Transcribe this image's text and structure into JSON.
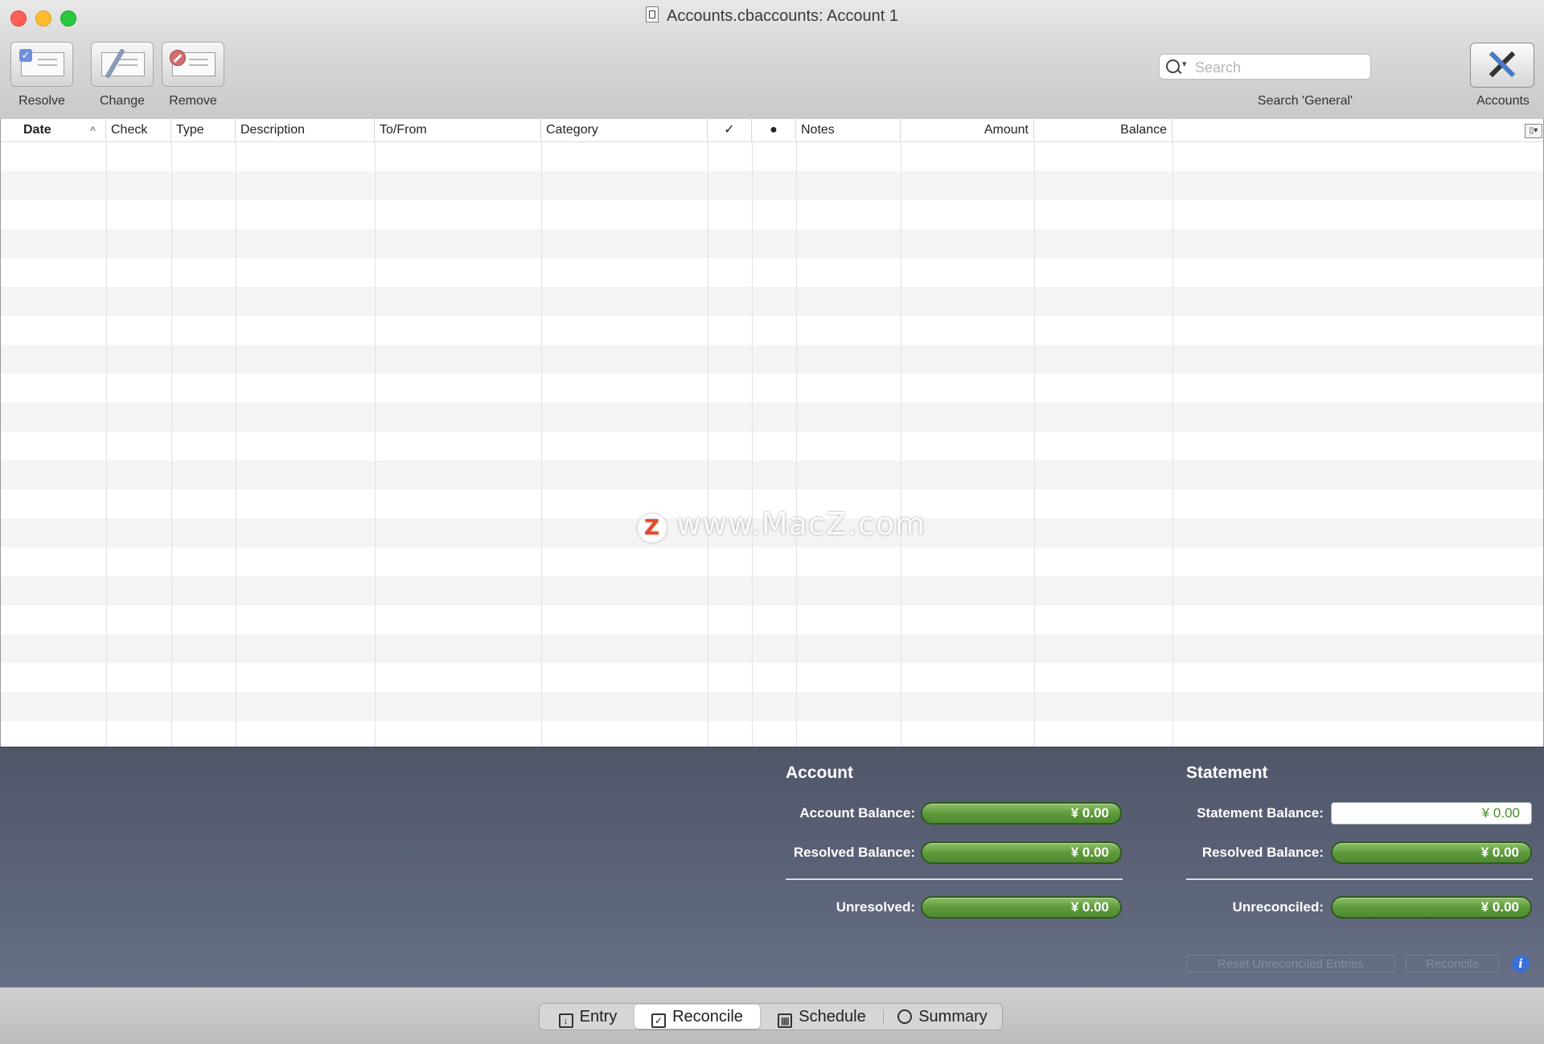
{
  "window": {
    "title": "Accounts.cbaccounts:  Account 1"
  },
  "toolbar": {
    "resolve_label": "Resolve",
    "change_label": "Change",
    "remove_label": "Remove",
    "search_placeholder": "Search",
    "search_caption": "Search 'General'",
    "accounts_label": "Accounts"
  },
  "table": {
    "columns": [
      "Date",
      "Check",
      "Type",
      "Description",
      "To/From",
      "Category",
      "✓",
      "●",
      "Notes",
      "Amount",
      "Balance"
    ],
    "sort_indicator": "^",
    "column_menu_icon": "▯▾",
    "rows": []
  },
  "watermark": {
    "logo_letter": "Z",
    "text": "www.MacZ.com"
  },
  "reconcile": {
    "account": {
      "title": "Account",
      "account_balance_label": "Account Balance:",
      "account_balance": "¥ 0.00",
      "resolved_balance_label": "Resolved Balance:",
      "resolved_balance": "¥ 0.00",
      "unresolved_label": "Unresolved:",
      "unresolved": "¥ 0.00"
    },
    "statement": {
      "title": "Statement",
      "statement_balance_label": "Statement Balance:",
      "statement_balance": "¥ 0.00",
      "resolved_balance_label": "Resolved Balance:",
      "resolved_balance": "¥ 0.00",
      "unreconciled_label": "Unreconciled:",
      "unreconciled": "¥ 0.00"
    },
    "reset_button": "Reset Unreconciled Entries",
    "reconcile_button": "Reconcile",
    "info_icon": "i"
  },
  "tabs": [
    {
      "label": "Entry",
      "icon": "entry-icon",
      "active": false
    },
    {
      "label": "Reconcile",
      "icon": "checkbox-icon",
      "active": true
    },
    {
      "label": "Schedule",
      "icon": "calendar-grid-icon",
      "active": false
    },
    {
      "label": "Summary",
      "icon": "pie-chart-icon",
      "active": false
    }
  ],
  "colors": {
    "balance_pill": "#5e9a3c",
    "panel_bg": "#5b6277",
    "info_blue": "#3a6fd8"
  }
}
